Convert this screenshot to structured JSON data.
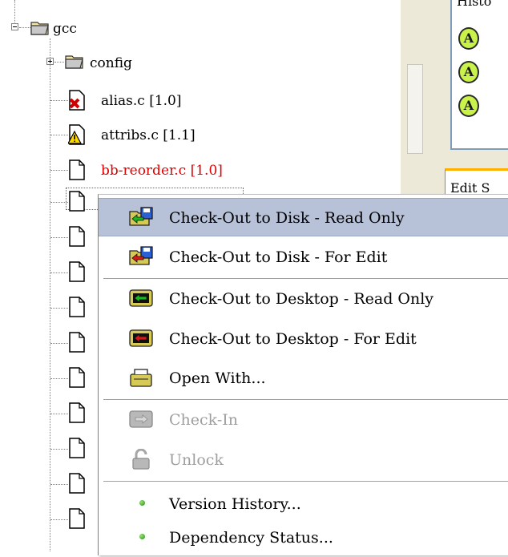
{
  "tree": {
    "root": {
      "label": "gcc",
      "expanded": true
    },
    "nodes": [
      {
        "label": "config",
        "type": "folder",
        "expanded": false
      },
      {
        "label": "alias.c  [1.0]",
        "type": "file",
        "status": "error",
        "color": "#000000"
      },
      {
        "label": "attribs.c  [1.1]",
        "type": "file",
        "status": "warning",
        "color": "#000000"
      },
      {
        "label": "bb-reorder.c  [1.0]",
        "type": "file",
        "status": "normal",
        "color": "#e00000"
      }
    ]
  },
  "side_panel": {
    "header_fragment": "Histo",
    "avatar_letter": "A",
    "tab_fragment": "Edit S"
  },
  "context_menu": {
    "items": [
      {
        "label": "Check-Out to Disk - Read Only",
        "icon": "checkout-disk-readonly-icon",
        "enabled": true,
        "highlighted": true
      },
      {
        "label": "Check-Out to Disk - For Edit",
        "icon": "checkout-disk-edit-icon",
        "enabled": true
      },
      {
        "label": "Check-Out to Desktop - Read Only",
        "icon": "checkout-desktop-readonly-icon",
        "enabled": true
      },
      {
        "label": "Check-Out to Desktop - For Edit",
        "icon": "checkout-desktop-edit-icon",
        "enabled": true
      },
      {
        "label": "Open With...",
        "icon": "open-with-icon",
        "enabled": true
      },
      {
        "label": "Check-In",
        "icon": "check-in-icon",
        "enabled": false
      },
      {
        "label": "Unlock",
        "icon": "unlock-icon",
        "enabled": false
      },
      {
        "label": "Version History...",
        "icon": "bullet-icon",
        "enabled": true
      },
      {
        "label": "Dependency Status...",
        "icon": "bullet-icon",
        "enabled": true
      }
    ]
  },
  "colors": {
    "highlight": "#b7c2d8",
    "modified_file_text": "#e00000",
    "disabled_text": "#9e9e9e"
  }
}
